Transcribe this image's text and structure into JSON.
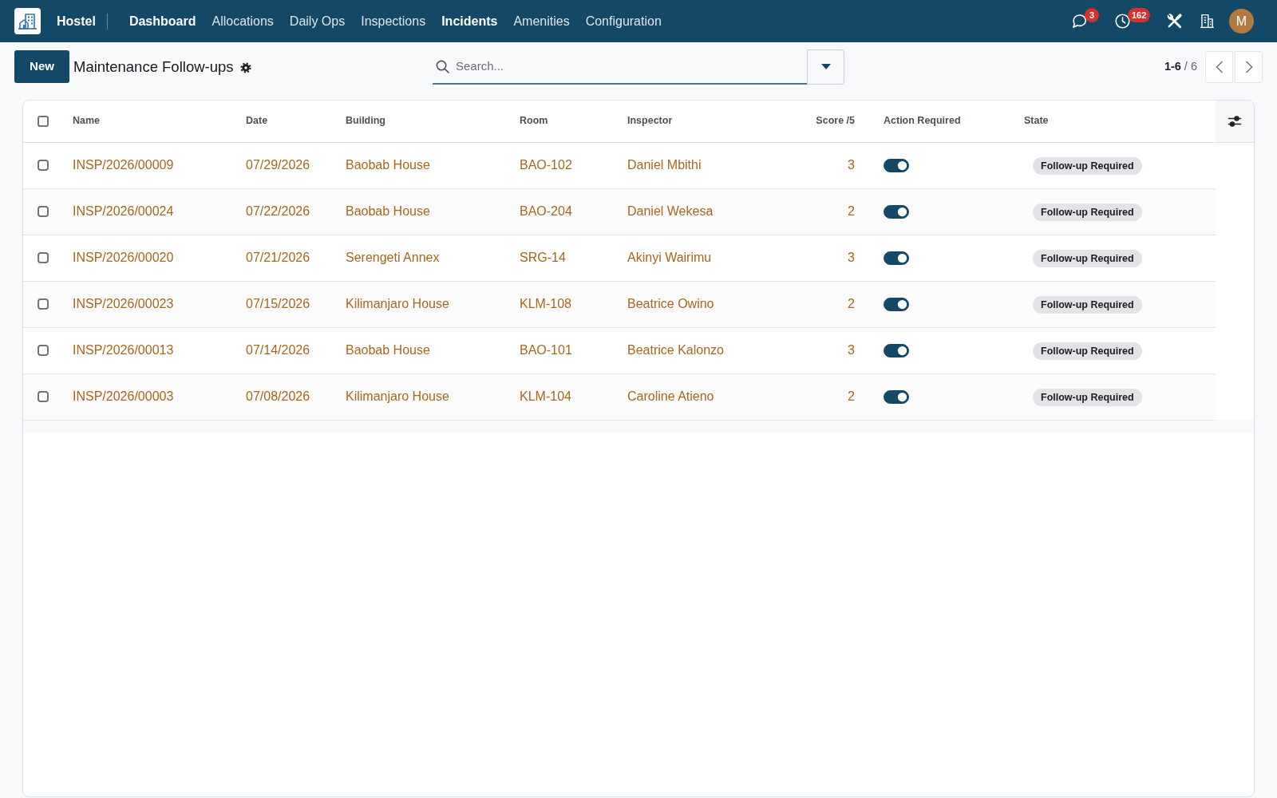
{
  "navbar": {
    "app_name": "Hostel",
    "menu": [
      {
        "label": "Dashboard",
        "emphasized": true
      },
      {
        "label": "Allocations",
        "emphasized": false
      },
      {
        "label": "Daily Ops",
        "emphasized": false
      },
      {
        "label": "Inspections",
        "emphasized": false
      },
      {
        "label": "Incidents",
        "emphasized": true
      },
      {
        "label": "Amenities",
        "emphasized": false
      },
      {
        "label": "Configuration",
        "emphasized": false
      }
    ],
    "message_count": "3",
    "activity_count": "162",
    "avatar_initial": "M"
  },
  "control_panel": {
    "new_button": "New",
    "title": "Maintenance Follow-ups",
    "search": {
      "placeholder": "Search..."
    },
    "pager": "**1-6** / 6"
  },
  "table": {
    "select_all": {
      "checked": false
    },
    "columns": [
      {
        "label": "Name",
        "kind": "text"
      },
      {
        "label": "Date",
        "kind": "text"
      },
      {
        "label": "Building",
        "kind": "text"
      },
      {
        "label": "Room",
        "kind": "text"
      },
      {
        "label": "Inspector",
        "kind": "text"
      },
      {
        "label": "Score /5",
        "kind": "number"
      },
      {
        "label": "Action Required",
        "kind": "toggle"
      },
      {
        "label": "State",
        "kind": "tag"
      }
    ],
    "rows": [
      {
        "selected": false,
        "name": "INSP/2026/00009",
        "date": "07/29/2026",
        "building": "Baobab House",
        "room": "BAO-102",
        "inspector": "Daniel Mbithi",
        "score": "3",
        "action_required": true,
        "state": "Follow-up Required"
      },
      {
        "selected": false,
        "name": "INSP/2026/00024",
        "date": "07/22/2026",
        "building": "Baobab House",
        "room": "BAO-204",
        "inspector": "Daniel Wekesa",
        "score": "2",
        "action_required": true,
        "state": "Follow-up Required"
      },
      {
        "selected": false,
        "name": "INSP/2026/00020",
        "date": "07/21/2026",
        "building": "Serengeti Annex",
        "room": "SRG-14",
        "inspector": "Akinyi Wairimu",
        "score": "3",
        "action_required": true,
        "state": "Follow-up Required"
      },
      {
        "selected": false,
        "name": "INSP/2026/00023",
        "date": "07/15/2026",
        "building": "Kilimanjaro House",
        "room": "KLM-108",
        "inspector": "Beatrice Owino",
        "score": "2",
        "action_required": true,
        "state": "Follow-up Required"
      },
      {
        "selected": false,
        "name": "INSP/2026/00013",
        "date": "07/14/2026",
        "building": "Baobab House",
        "room": "BAO-101",
        "inspector": "Beatrice Kalonzo",
        "score": "3",
        "action_required": true,
        "state": "Follow-up Required"
      },
      {
        "selected": false,
        "name": "INSP/2026/00003",
        "date": "07/08/2026",
        "building": "Kilimanjaro House",
        "room": "KLM-104",
        "inspector": "Caroline Atieno",
        "score": "2",
        "action_required": true,
        "state": "Follow-up Required"
      }
    ]
  }
}
